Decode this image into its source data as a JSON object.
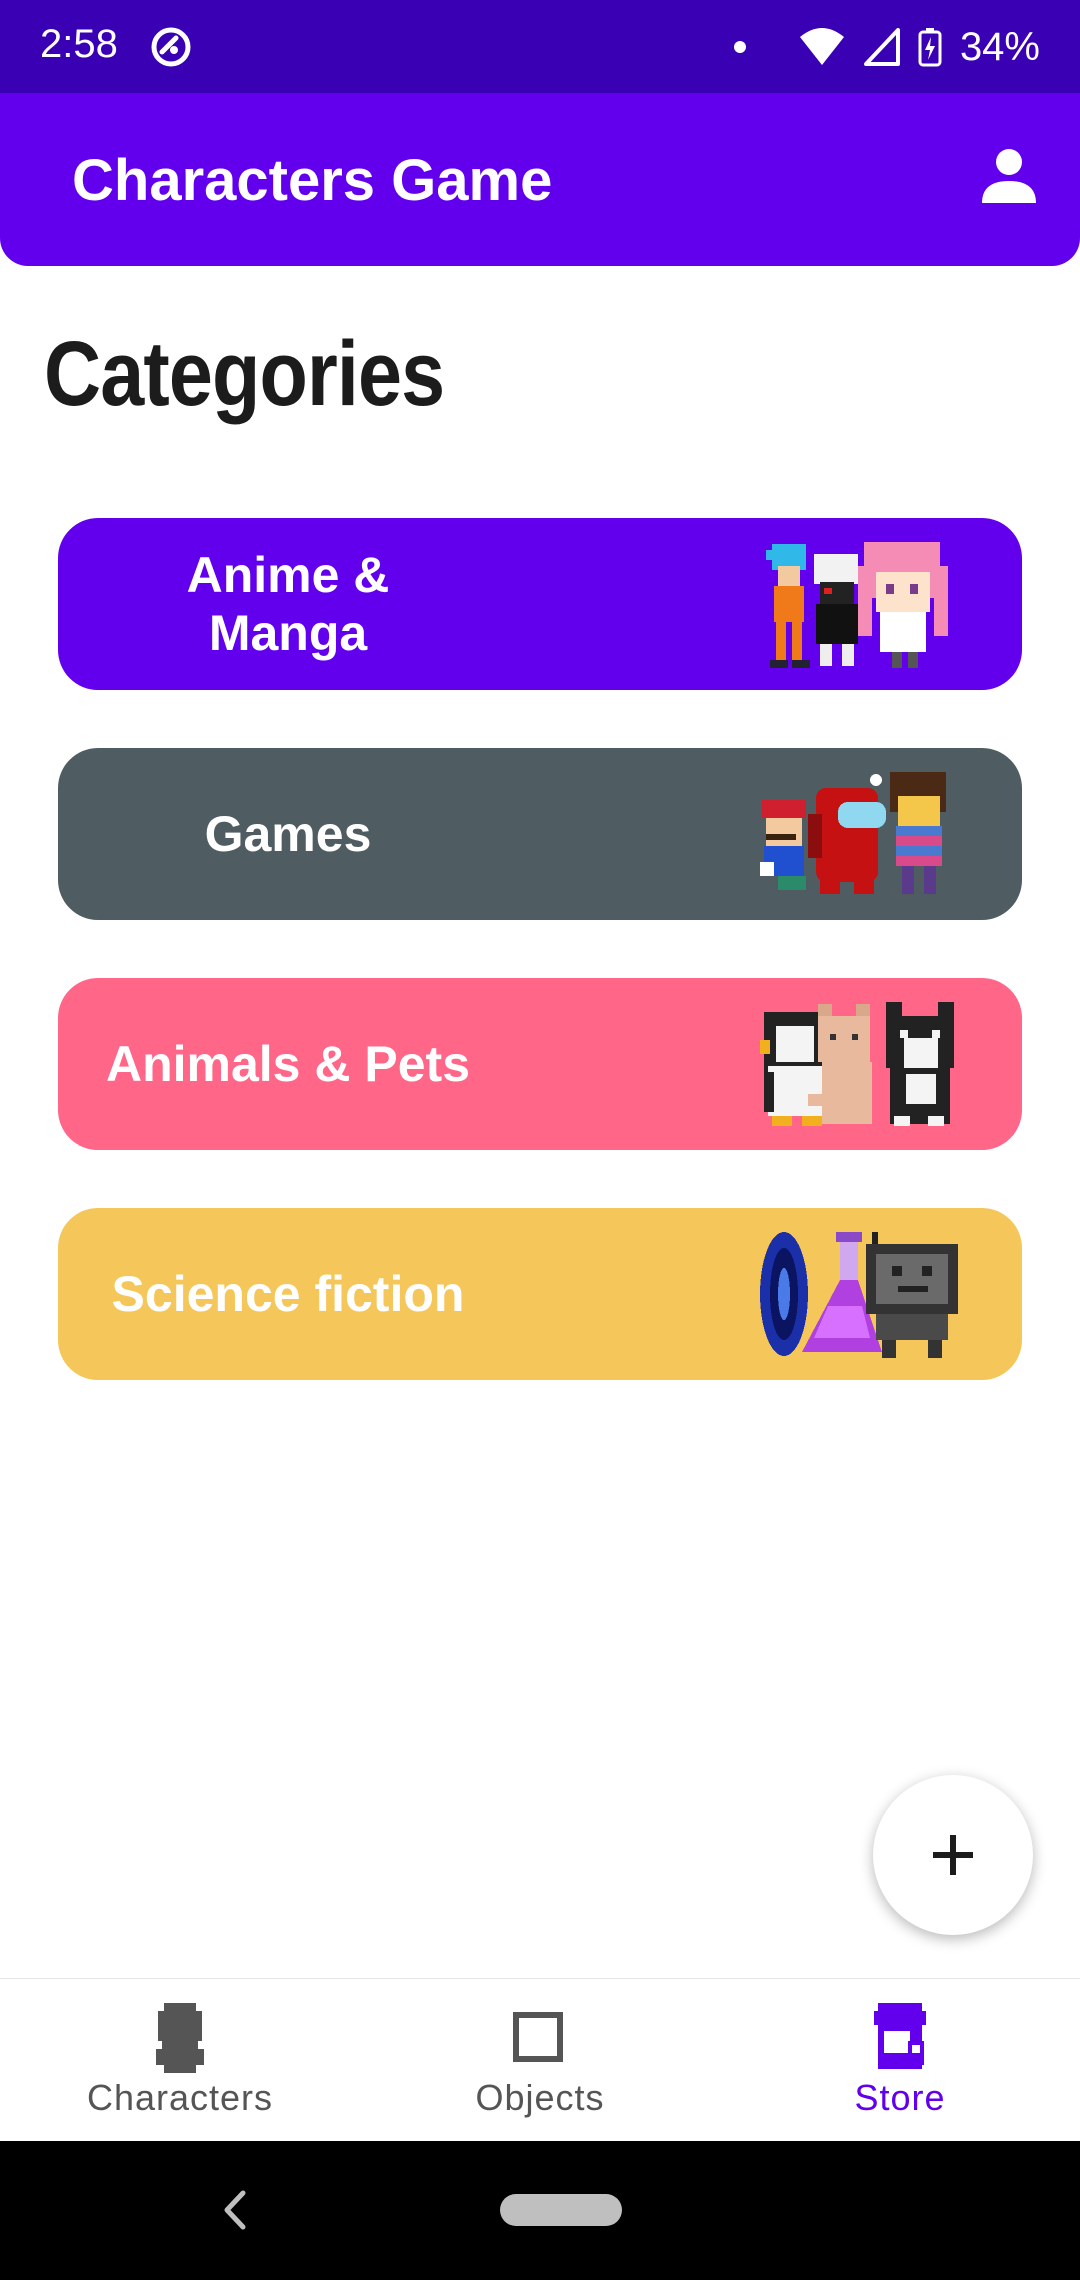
{
  "status_bar": {
    "time": "2:58",
    "battery_percent": "34%",
    "icons": [
      "app-notification-icon",
      "dot-icon",
      "wifi-icon",
      "cell-signal-icon",
      "battery-charging-icon"
    ]
  },
  "app_bar": {
    "title": "Characters Game",
    "profile_icon": "person-icon",
    "background_color": "#6200ee"
  },
  "page": {
    "heading": "Categories"
  },
  "categories": [
    {
      "label": "Anime &\nManga",
      "color": "#6200ee",
      "art": "anime-characters-pixel-art"
    },
    {
      "label": "Games",
      "color": "#4f5d62",
      "art": "game-characters-pixel-art"
    },
    {
      "label": "Animals & Pets",
      "color": "#ff6688",
      "art": "animals-pixel-art"
    },
    {
      "label": "Science fiction",
      "color": "#f5c65a",
      "art": "scifi-pixel-art"
    }
  ],
  "fab": {
    "icon": "plus-icon"
  },
  "bottom_nav": {
    "items": [
      {
        "label": "Characters",
        "icon": "character-silhouette-icon",
        "active": false
      },
      {
        "label": "Objects",
        "icon": "square-outline-icon",
        "active": false
      },
      {
        "label": "Store",
        "icon": "store-icon",
        "active": true
      }
    ],
    "active_color": "#6200ee"
  },
  "system_nav": {
    "icons": [
      "back-chevron-icon",
      "home-pill-icon"
    ]
  }
}
